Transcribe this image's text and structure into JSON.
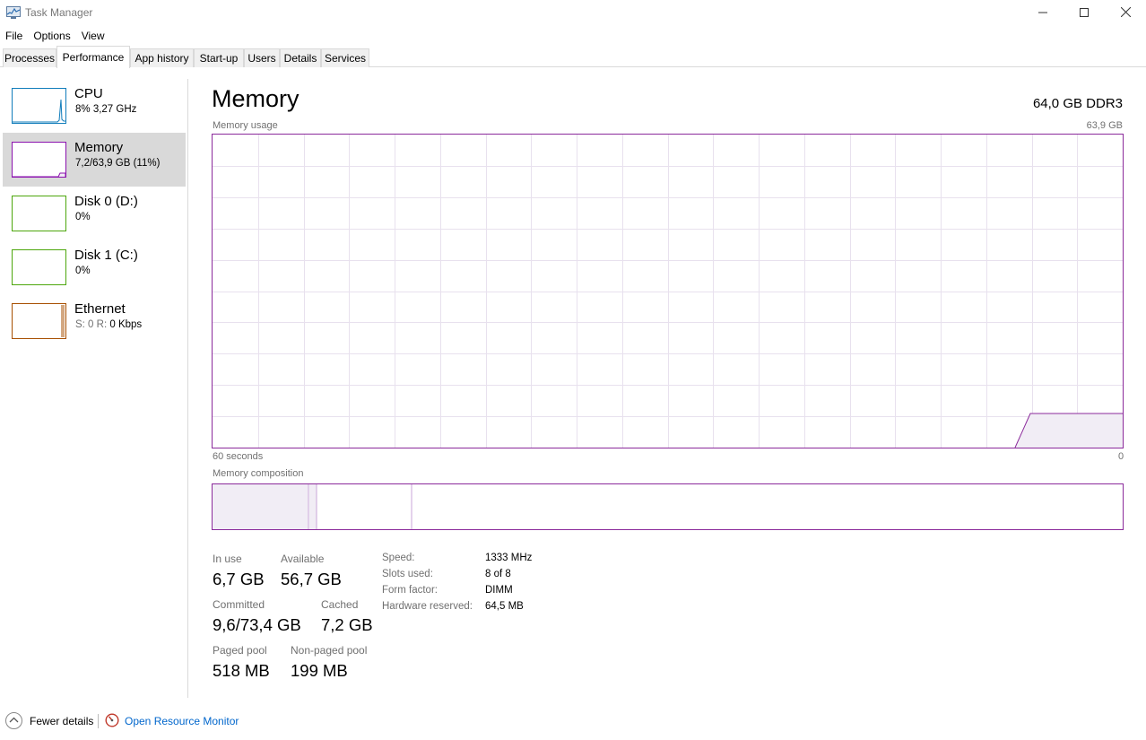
{
  "window": {
    "title": "Task Manager",
    "icons": {
      "app": "task-manager-icon",
      "minimize": "minimize-icon",
      "maximize": "maximize-icon",
      "close": "close-icon"
    }
  },
  "menu": [
    "File",
    "Options",
    "View"
  ],
  "tabs": [
    {
      "label": "Processes",
      "active": false
    },
    {
      "label": "Performance",
      "active": true
    },
    {
      "label": "App history",
      "active": false
    },
    {
      "label": "Start-up",
      "active": false
    },
    {
      "label": "Users",
      "active": false
    },
    {
      "label": "Details",
      "active": false
    },
    {
      "label": "Services",
      "active": false
    }
  ],
  "sidebar": {
    "items": [
      {
        "title": "CPU",
        "subtitle": "8%  3,27 GHz",
        "color": "#117dbb",
        "selected": false
      },
      {
        "title": "Memory",
        "subtitle": "7,2/63,9 GB (11%)",
        "color": "#8b12ae",
        "selected": true
      },
      {
        "title": "Disk 0 (D:)",
        "subtitle": "0%",
        "color": "#4da60c",
        "selected": false
      },
      {
        "title": "Disk 1 (C:)",
        "subtitle": "0%",
        "color": "#4da60c",
        "selected": false
      },
      {
        "title": "Ethernet",
        "subtitle_label": "S: 0 R:",
        "subtitle_value": "0 Kbps",
        "color": "#a74f01",
        "selected": false
      }
    ]
  },
  "main": {
    "title": "Memory",
    "spec": "64,0 GB DDR3",
    "usage_chart": {
      "label": "Memory usage",
      "max_label": "63,9 GB",
      "time_label": "60 seconds",
      "min_label": "0",
      "accent": "#8b2a9b",
      "fill": "#f1edf5",
      "grid": "#e8e1ee"
    },
    "composition": {
      "label": "Memory composition"
    },
    "stats": {
      "in_use_label": "In use",
      "in_use": "6,7 GB",
      "available_label": "Available",
      "available": "56,7 GB",
      "committed_label": "Committed",
      "committed": "9,6/73,4 GB",
      "cached_label": "Cached",
      "cached": "7,2 GB",
      "paged_label": "Paged pool",
      "paged": "518 MB",
      "nonpaged_label": "Non-paged pool",
      "nonpaged": "199 MB"
    },
    "info": {
      "speed_label": "Speed:",
      "speed": "1333 MHz",
      "slots_label": "Slots used:",
      "slots": "8 of 8",
      "form_label": "Form factor:",
      "form": "DIMM",
      "reserved_label": "Hardware reserved:",
      "reserved": "64,5 MB"
    }
  },
  "footer": {
    "fewer_details": "Fewer details",
    "resource_monitor": "Open Resource Monitor",
    "icons": {
      "fewer": "chevron-up-icon",
      "monitor": "resource-monitor-icon"
    }
  }
}
